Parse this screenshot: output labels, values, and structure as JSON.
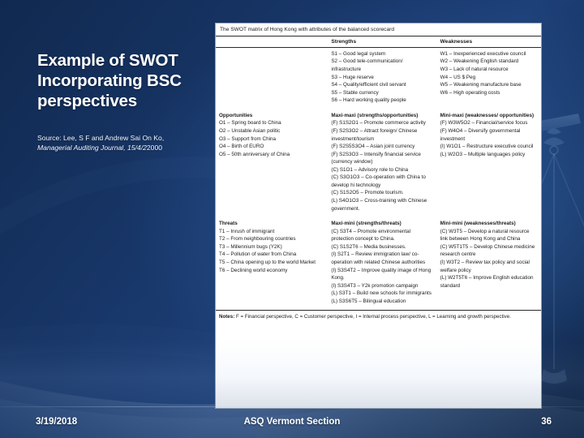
{
  "slide": {
    "title": "Example of SWOT Incorporating BSC perspectives",
    "source_label": "Source: Lee, S F and Andrew Sai On Ko,",
    "source_journal": "Managerial Auditing Journal, 15/4/2",
    "source_year": "2000"
  },
  "figure": {
    "caption": "The SWOT matrix of Hong Kong with attributes of the balanced scorecard",
    "columns": {
      "blank": "",
      "strengths": "Strengths",
      "weaknesses": "Weaknesses"
    },
    "strengths": [
      "S1 – Good legal system",
      "S2 – Good tele-communication/ infrastructure",
      "S3 – Huge reserve",
      "S4 – Quality/efficient civil servant",
      "S5 – Stable currency",
      "S6 – Hard working quality people"
    ],
    "weaknesses": [
      "W1 – Inexperienced executive council",
      "W2 – Weakening English standard",
      "W3 – Lack of natural resource",
      "W4 – US $ Peg",
      "W5 – Weakening manufacture base",
      "W6 – High operating costs"
    ],
    "opportunities_head": "Opportunities",
    "opportunities": [
      "O1 – Spring board to China",
      "O2 – Unstable Asian politic",
      "O3 – Support from China",
      "O4 – Birth of EURO",
      "O5 – 50th anniversary of China"
    ],
    "maxi_maxi_head": "Maxi-maxi (strengths/opportunities)",
    "maxi_maxi": [
      "(F) S1S2O1 – Promote commerce activity",
      "(F) S2S3O2 – Attract foreign/ Chinese investment/tourism",
      "(F) S2S5S3O4 – Asian joint currency",
      "(F) S2S3O3 – Intensify financial service (currency window)",
      "(C) S1O1 – Advisory role to China",
      "(C) S3O1O3 – Co-operation with China to develop hi technology",
      "(C) S1S2O5 – Promote tourism.",
      "(L) S4O1O3 – Cross-training with Chinese government."
    ],
    "mini_maxi_head": "Mini-maxi (weaknesses/ opportunities)",
    "mini_maxi": [
      "(F) W3W5O2 – Financial/service focus",
      "(F) W4O4 – Diversify governmental investment",
      "(I) W1O1 – Restructure executive council",
      "(L) W2O3 – Multiple languages policy"
    ],
    "threats_head": "Threats",
    "threats": [
      "T1 – Inrush of immigrant",
      "T2 – From neighbouring countries",
      "T3 – Millennium bugs (Y2K)",
      "T4 – Pollution of water from China",
      "T5 – China opening up to the world Market",
      "T6 – Declining world economy"
    ],
    "maxi_mini_head": "Maxi-mini (strengths/threats)",
    "maxi_mini": [
      "(C) S3T4 – Promote environmental protection concept to China.",
      "(C) S1S2T6 – Media businesses.",
      "(I) S2T1 – Review immigration law/ co-operation with related Chinese authorities",
      "(I) S3S4T2 – Improve quality image of Hong Kong.",
      "(I) S3S4T3 – Y2k promotion campaign",
      "(L) S3T1 – Build new schools for immigrants",
      "(L) S3S6T5 – Bilingual education"
    ],
    "mini_mini_head": "Mini-mini (weaknesses/threats)",
    "mini_mini": [
      "(C) W3T5 – Develop a natural resource link between Hong Kong and China",
      "(C) W5T1T5 – Develop Chinese medicine research centre",
      "(I) W3T2 – Review tax policy and social welfare policy",
      "(L) W2T5T6 – Improve English education standard"
    ],
    "notes_label": "Notes:",
    "notes_text": " F = Financial perspective, C = Customer perspective, I = Internal process perspective, L = Learning and growth perspective."
  },
  "footer": {
    "date": "3/19/2018",
    "center": "ASQ Vermont Section",
    "slide_number": "36"
  }
}
